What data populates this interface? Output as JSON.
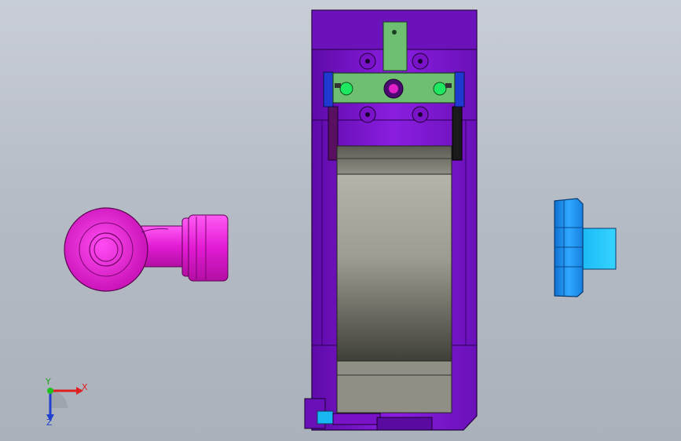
{
  "viewport": {
    "background_top": "#c9ced6",
    "background_bottom": "#aab1bb"
  },
  "parts": [
    {
      "name": "pipe-elbow-part",
      "color": "#e619d8"
    },
    {
      "name": "fixture-body-part",
      "color": "#7a12c8"
    },
    {
      "name": "roller-part",
      "color": "#9a9a8e"
    },
    {
      "name": "clamp-plate-part",
      "color": "#6fbf73"
    },
    {
      "name": "flange-fitting-part",
      "color": "#1f9bf0"
    }
  ],
  "triad": {
    "x_label": "X",
    "y_label": "Y",
    "z_label": "Z",
    "x_color": "#e02020",
    "y_color": "#20c020",
    "z_color": "#2040d0"
  }
}
